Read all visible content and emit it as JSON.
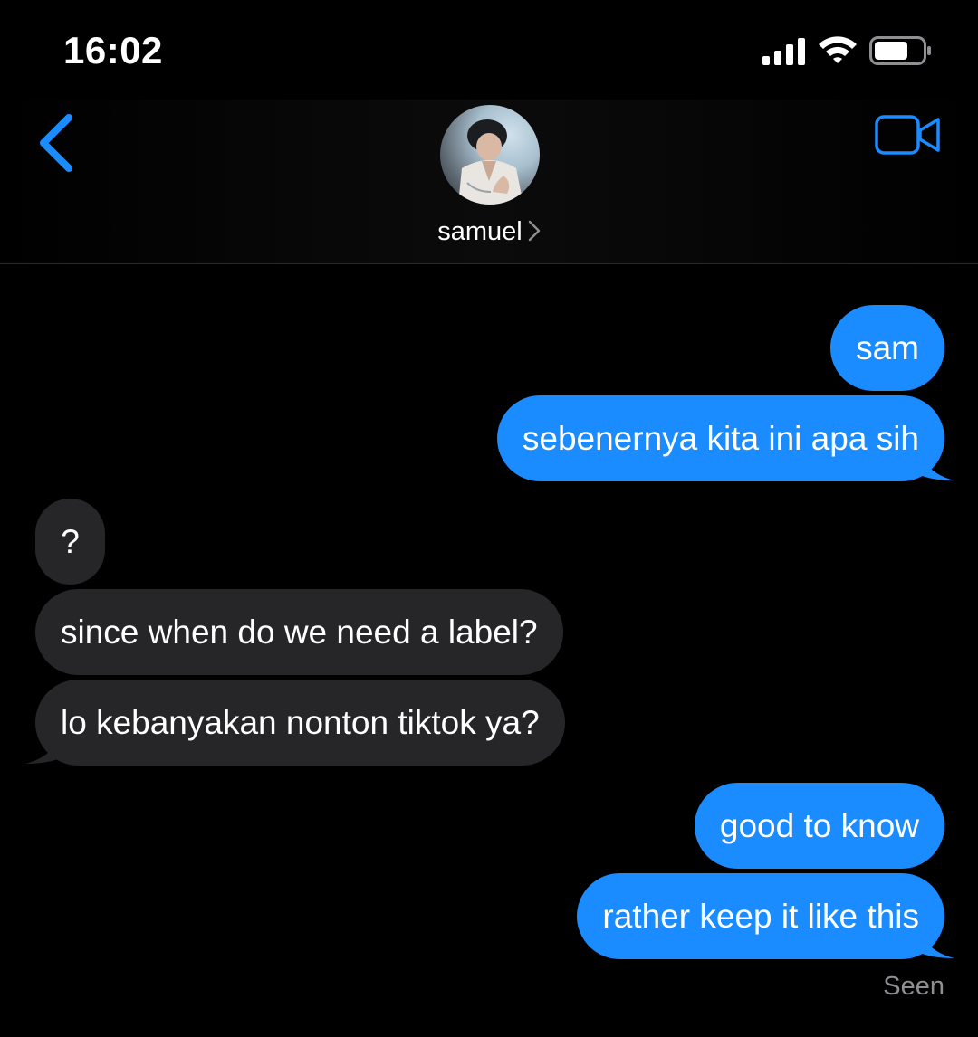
{
  "status_bar": {
    "time": "16:02",
    "icons": [
      "cellular-signal-icon",
      "wifi-icon",
      "battery-icon"
    ]
  },
  "nav": {
    "contact_name": "samuel",
    "icons": [
      "back-chevron-icon",
      "video-call-icon",
      "chevron-right-icon"
    ]
  },
  "colors": {
    "accent": "#1a8cff",
    "incoming_bubble": "#262629",
    "background": "#000000",
    "seen_text": "#8e8e93"
  },
  "messages": [
    {
      "direction": "outgoing",
      "text": "sam"
    },
    {
      "direction": "outgoing",
      "text": "sebenernya kita ini apa sih"
    },
    {
      "direction": "incoming",
      "text": "?"
    },
    {
      "direction": "incoming",
      "text": "since when do we need a label?"
    },
    {
      "direction": "incoming",
      "text": "lo kebanyakan nonton tiktok ya?"
    },
    {
      "direction": "outgoing",
      "text": "good to know"
    },
    {
      "direction": "outgoing",
      "text": "rather keep it like this"
    }
  ],
  "seen_label": "Seen"
}
